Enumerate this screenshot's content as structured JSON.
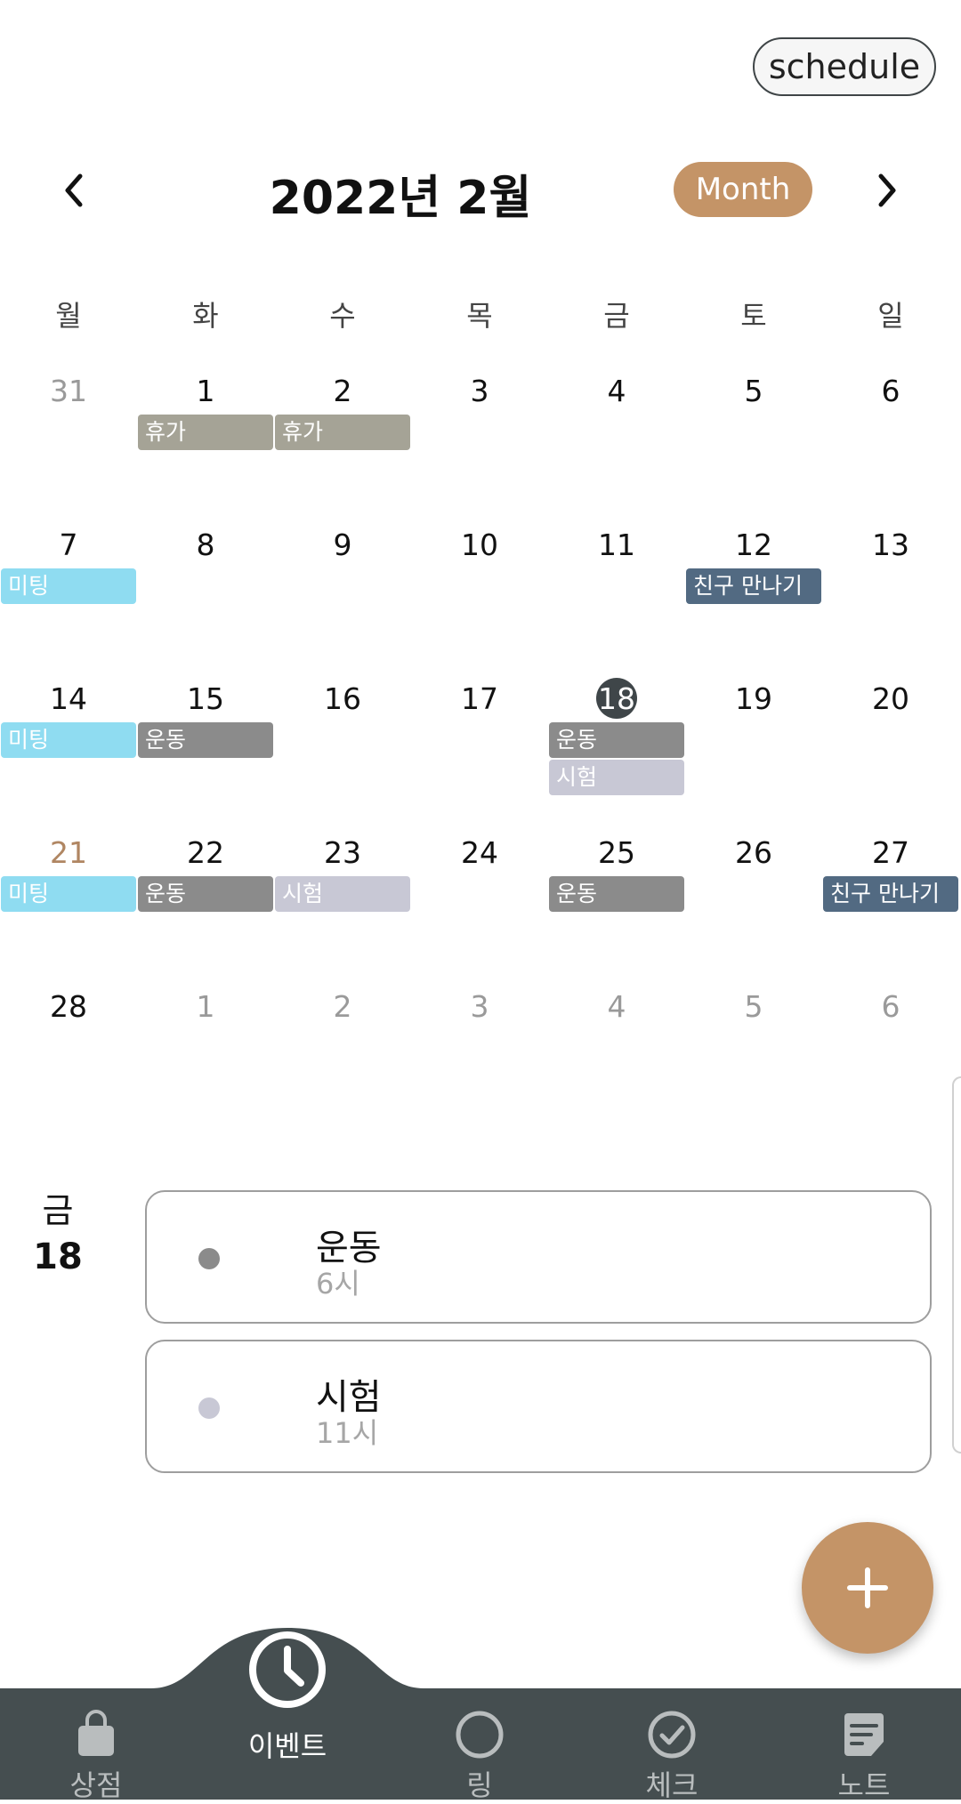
{
  "header": {
    "schedule_label": "schedule",
    "title": "2022년 2월",
    "view_toggle": "Month"
  },
  "weekdays": [
    "월",
    "화",
    "수",
    "목",
    "금",
    "토",
    "일"
  ],
  "weeks": [
    [
      "31",
      "1",
      "2",
      "3",
      "4",
      "5",
      "6"
    ],
    [
      "7",
      "8",
      "9",
      "10",
      "11",
      "12",
      "13"
    ],
    [
      "14",
      "15",
      "16",
      "17",
      "18",
      "19",
      "20"
    ],
    [
      "21",
      "22",
      "23",
      "24",
      "25",
      "26",
      "27"
    ],
    [
      "28",
      "1",
      "2",
      "3",
      "4",
      "5",
      "6"
    ]
  ],
  "events": [
    {
      "label": "휴가",
      "week": 0,
      "col": 1,
      "lane": 0,
      "color": "#a5a396"
    },
    {
      "label": "휴가",
      "week": 0,
      "col": 2,
      "lane": 0,
      "color": "#a5a396"
    },
    {
      "label": "미팅",
      "week": 1,
      "col": 0,
      "lane": 0,
      "color": "#8fdcf1"
    },
    {
      "label": "친구 만나기",
      "week": 1,
      "col": 5,
      "lane": 0,
      "color": "#526a82"
    },
    {
      "label": "미팅",
      "week": 2,
      "col": 0,
      "lane": 0,
      "color": "#8fdcf1"
    },
    {
      "label": "운동",
      "week": 2,
      "col": 1,
      "lane": 0,
      "color": "#8b8b8b"
    },
    {
      "label": "운동",
      "week": 2,
      "col": 4,
      "lane": 0,
      "color": "#8b8b8b"
    },
    {
      "label": "시험",
      "week": 2,
      "col": 4,
      "lane": 1,
      "color": "#c8c8d5"
    },
    {
      "label": "미팅",
      "week": 3,
      "col": 0,
      "lane": 0,
      "color": "#8fdcf1"
    },
    {
      "label": "운동",
      "week": 3,
      "col": 1,
      "lane": 0,
      "color": "#8b8b8b"
    },
    {
      "label": "시험",
      "week": 3,
      "col": 2,
      "lane": 0,
      "color": "#c8c8d5"
    },
    {
      "label": "운동",
      "week": 3,
      "col": 4,
      "lane": 0,
      "color": "#8b8b8b"
    },
    {
      "label": "친구 만나기",
      "week": 3,
      "col": 6,
      "lane": 0,
      "color": "#526a82"
    }
  ],
  "selected_day": {
    "weekday": "금",
    "day": "18",
    "events": [
      {
        "title": "운동",
        "time": "6시",
        "color": "#8b8b8b"
      },
      {
        "title": "시험",
        "time": "11시",
        "color": "#c8c8d5"
      }
    ]
  },
  "fab_icon": "plus-icon",
  "tabs": [
    {
      "label": "상점",
      "icon": "shopping-bag-icon"
    },
    {
      "label": "이벤트",
      "icon": "clock-icon"
    },
    {
      "label": "링",
      "icon": "ring-icon"
    },
    {
      "label": "체크",
      "icon": "check-circle-icon"
    },
    {
      "label": "노트",
      "icon": "note-icon"
    }
  ],
  "colors": {
    "accent": "#c49467",
    "bar": "#454e50",
    "today": "#3f4649",
    "holiday": "#b08662"
  }
}
